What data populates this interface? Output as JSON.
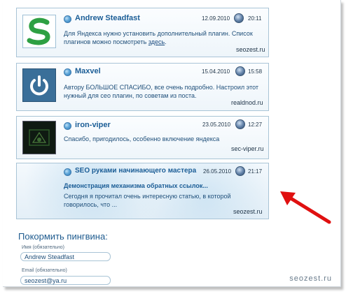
{
  "comments": [
    {
      "author": "Andrew Steadfast",
      "date": "12.09.2010",
      "time": "20:11",
      "text_before": "Для Яндекса нужно установить дополнительный плагин. Список плагинов можно посмотреть ",
      "link": "здесь",
      "text_after": ".",
      "site": "seozest.ru",
      "avatar": "s-logo"
    },
    {
      "author": "Maxvel",
      "date": "15.04.2010",
      "time": "15:58",
      "text": "Автору БОЛЬШОЕ СПАСИБО, все очень подробно. Настроил этот нужный для сео плагин, по советам из поста.",
      "site": "realdnod.ru",
      "avatar": "power-button"
    },
    {
      "author": "iron-viper",
      "date": "23.05.2010",
      "time": "12:27",
      "text": "Спасибо, пригодилось, особенно включение яндекса",
      "site": "sec-viper.ru",
      "avatar": "dark-emblem"
    },
    {
      "author": "SEO руками начинающего мастера",
      "date": "26.05.2010",
      "time": "21:17",
      "subject": "Демонстрация механизма обратных ссылок...",
      "text": "Сегодня я прочитал очень интересную статью, в которой говорилось, что ...",
      "site": "seozest.ru"
    }
  ],
  "form": {
    "title": "Покормить пингвина:",
    "name_label": "Имя (обязательно)",
    "name_value": "Andrew Steadfast",
    "email_label": "Email (обязательно)",
    "email_value": "seozest@ya.ru"
  },
  "watermark": "seozest.ru",
  "colors": {
    "accent": "#1b5d96",
    "border": "#a9c4d6",
    "arrow": "#e01010"
  }
}
